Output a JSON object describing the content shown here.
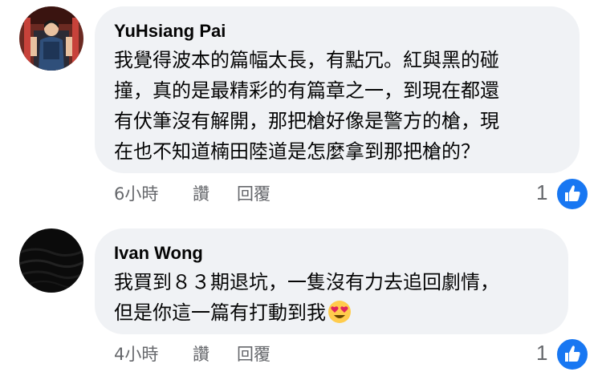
{
  "colors": {
    "bubble_bg": "#f0f2f5",
    "meta_text": "#65676b",
    "like_blue": "#1877f2"
  },
  "comments": [
    {
      "author": "YuHsiang Pai",
      "avatar_icon": "person-photo-avatar",
      "text": "我覺得波本的篇幅太長，有點冗。紅與黑的碰\n撞，真的是最精彩的有篇章之一，到現在都還\n有伏筆沒有解開，那把槍好像是警方的槍，現\n在也不知道楠田陸道是怎麼拿到那把槍的？",
      "time": "6小時",
      "like_label": "讚",
      "reply_label": "回覆",
      "reaction_count": "1"
    },
    {
      "author": "Ivan Wong",
      "avatar_icon": "dark-abstract-avatar",
      "text": "我買到８３期退坑，一隻沒有力去追回劇情，\n但是你這一篇有打動到我",
      "emoji": "heart-eyes-emoji",
      "time": "4小時",
      "like_label": "讚",
      "reply_label": "回覆",
      "reaction_count": "1"
    }
  ]
}
